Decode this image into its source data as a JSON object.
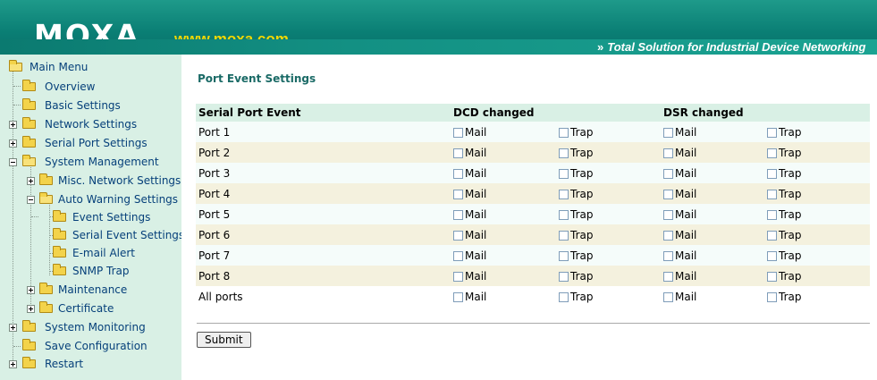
{
  "header": {
    "logo": "MOXA",
    "url": "www.moxa.com",
    "tagline": "Total Solution for Industrial Device Networking"
  },
  "sidebar": {
    "items": [
      {
        "label": "Main Menu"
      },
      {
        "label": "Overview"
      },
      {
        "label": "Basic Settings"
      },
      {
        "label": "Network Settings"
      },
      {
        "label": "Serial Port Settings"
      },
      {
        "label": "System Management"
      },
      {
        "label": "Misc. Network Settings"
      },
      {
        "label": "Auto Warning Settings"
      },
      {
        "label": "Event Settings"
      },
      {
        "label": "Serial Event Settings"
      },
      {
        "label": "E-mail Alert"
      },
      {
        "label": "SNMP Trap"
      },
      {
        "label": "Maintenance"
      },
      {
        "label": "Certificate"
      },
      {
        "label": "System Monitoring"
      },
      {
        "label": "Save Configuration"
      },
      {
        "label": "Restart"
      }
    ]
  },
  "main": {
    "title": "Port Event Settings",
    "table": {
      "headers": [
        "Serial Port Event",
        "DCD changed",
        "DSR changed"
      ],
      "option_mail": "Mail",
      "option_trap": "Trap",
      "rows": [
        {
          "label": "Port 1"
        },
        {
          "label": "Port 2"
        },
        {
          "label": "Port 3"
        },
        {
          "label": "Port 4"
        },
        {
          "label": "Port 5"
        },
        {
          "label": "Port 6"
        },
        {
          "label": "Port 7"
        },
        {
          "label": "Port 8"
        },
        {
          "label": "All ports"
        }
      ]
    },
    "submit_label": "Submit"
  },
  "colors": {
    "header_teal": "#0a7e74",
    "url_yellow": "#f2d800",
    "sidebar_bg": "#d9f0e5",
    "title_green": "#1a6a66",
    "row_odd": "#f5fcfa",
    "row_even": "#f4f1de"
  },
  "icons": [
    "folder-icon",
    "expand-plus-icon",
    "collapse-minus-icon",
    "checkbox-icon"
  ]
}
